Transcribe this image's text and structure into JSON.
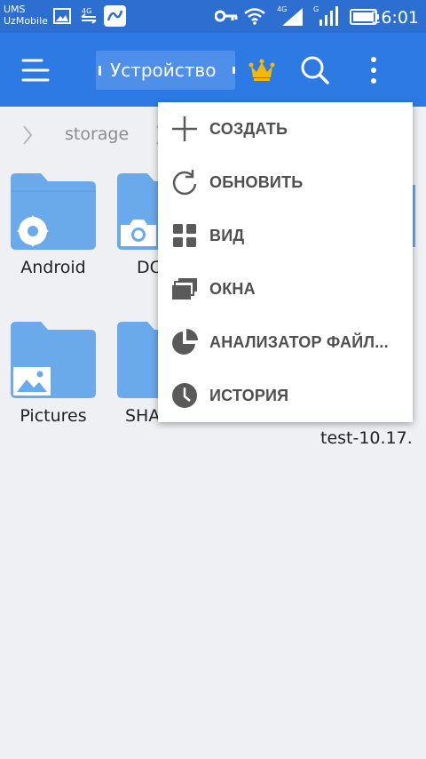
{
  "status_bar": {
    "carrier_line1": "UMS",
    "carrier_line2": "UzMobile",
    "net_label_1": "4G",
    "net_label_2": "G",
    "time": "16:01"
  },
  "toolbar": {
    "location_label": "Устройство"
  },
  "breadcrumb": {
    "segment": "storage"
  },
  "folders": [
    {
      "label": "Android",
      "badge_icon": "gear-icon"
    },
    {
      "label": "DC",
      "badge_icon": "camera-icon"
    },
    {
      "label": "Pictures",
      "badge_icon": "image-icon"
    },
    {
      "label": "SHA",
      "badge_icon": ""
    }
  ],
  "partial_labels": {
    "col4_row2": "test-10.17."
  },
  "menu": {
    "items": [
      {
        "label": "СОЗДАТЬ",
        "icon": "plus-icon"
      },
      {
        "label": "ОБНОВИТЬ",
        "icon": "refresh-icon"
      },
      {
        "label": "ВИД",
        "icon": "grid-view-icon"
      },
      {
        "label": "ОКНА",
        "icon": "windows-icon"
      },
      {
        "label": "АНАЛИЗАТОР ФАЙЛ...",
        "icon": "pie-chart-icon"
      },
      {
        "label": "ИСТОРИЯ",
        "icon": "clock-icon"
      }
    ]
  },
  "colors": {
    "toolbar": "#2d7ae5",
    "status_bar": "#2c6fd1",
    "folder": "#6aa9ea",
    "crown": "#f5b800"
  }
}
